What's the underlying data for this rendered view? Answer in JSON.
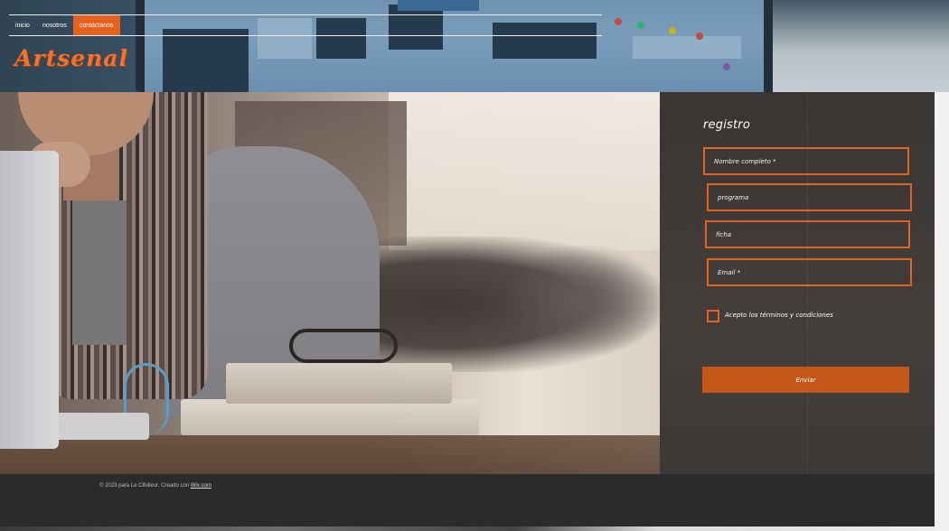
{
  "nav": {
    "items": [
      {
        "label": "inicio",
        "active": false
      },
      {
        "label": "nosotros",
        "active": false
      },
      {
        "label": "contáctanos",
        "active": true
      }
    ]
  },
  "brand": {
    "logo_text": "Artsenal",
    "accent_color": "#e8621d"
  },
  "form": {
    "title": "registro",
    "fields": [
      {
        "name": "nombre",
        "placeholder": "Nombre completo *"
      },
      {
        "name": "programa",
        "placeholder": "programa"
      },
      {
        "name": "ficha",
        "placeholder": "ficha"
      },
      {
        "name": "email",
        "placeholder": "Email *"
      }
    ],
    "terms_label": "Acepto los términos y condiciones",
    "submit_label": "Enviar",
    "border_color": "#e0631f",
    "button_color": "#c4561a"
  },
  "footer": {
    "text": "© 2023 para  Le Cifulleur. Creado con ",
    "link_text": "Wix.com"
  }
}
